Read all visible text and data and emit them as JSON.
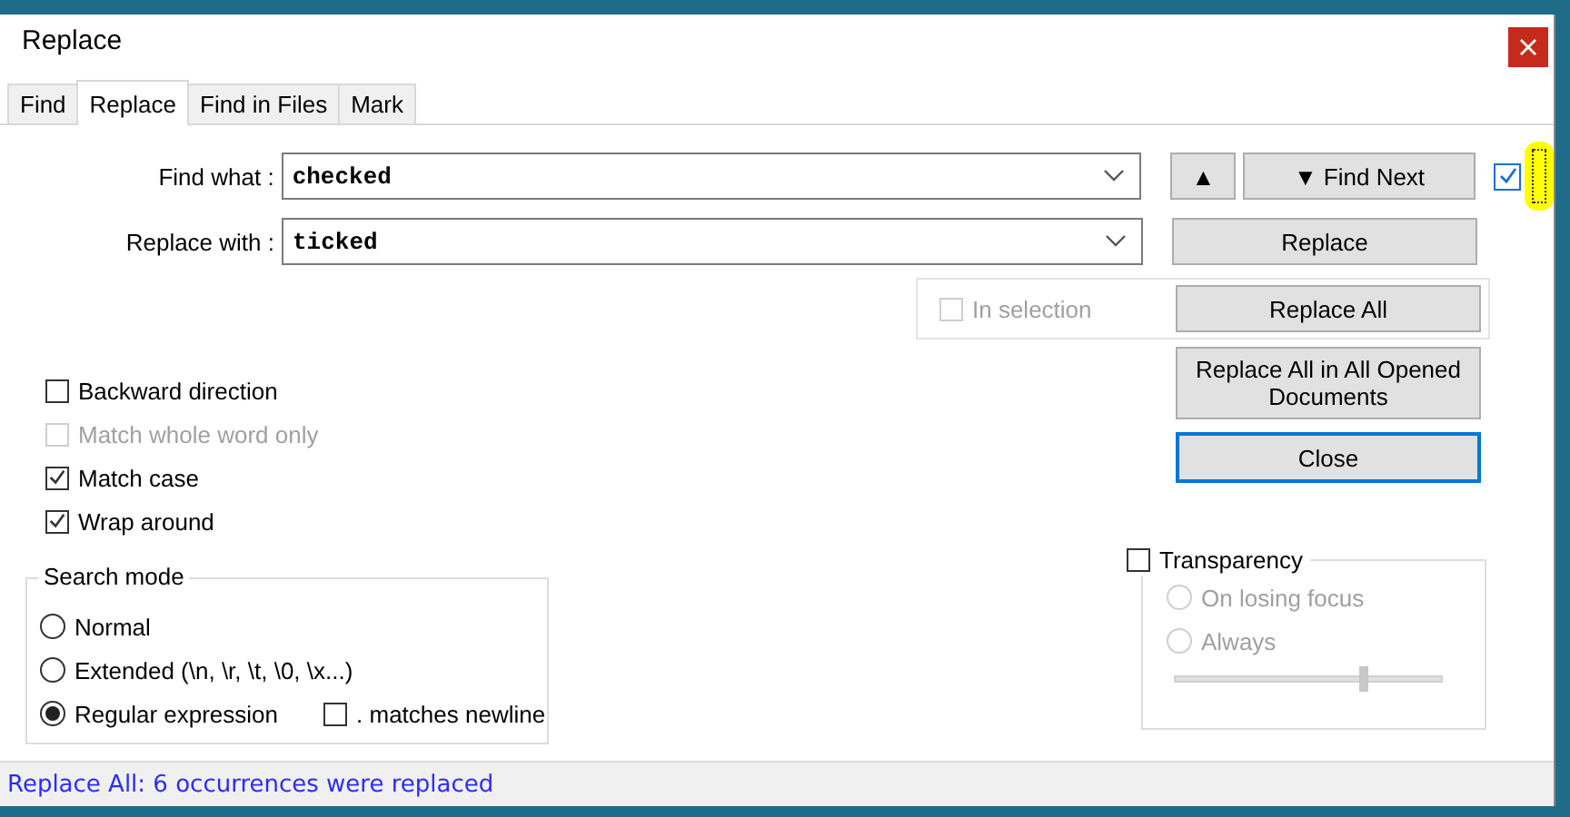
{
  "window": {
    "title": "Replace"
  },
  "tabs": [
    {
      "label": "Find",
      "selected": false
    },
    {
      "label": "Replace",
      "selected": true
    },
    {
      "label": "Find in Files",
      "selected": false
    },
    {
      "label": "Mark",
      "selected": false
    }
  ],
  "fields": [
    {
      "label": "Find what :",
      "value": "checked"
    },
    {
      "label": "Replace with :",
      "value": "ticked"
    }
  ],
  "up_button": {
    "label": "▲"
  },
  "find_next_button": {
    "label": "▼ Find Next"
  },
  "side_checkbox": {
    "checked": true
  },
  "replace_button": {
    "label": "Replace"
  },
  "in_selection": {
    "label": "In selection",
    "checked": false,
    "disabled": true
  },
  "replace_all_button": {
    "label": "Replace All"
  },
  "replace_all_opened_button": {
    "label": "Replace All in All Opened Documents"
  },
  "close_button": {
    "label": "Close",
    "focused": true
  },
  "options": [
    {
      "label": "Backward direction",
      "checked": false,
      "disabled": false
    },
    {
      "label": "Match whole word only",
      "checked": false,
      "disabled": true
    },
    {
      "label": "Match case",
      "checked": true,
      "disabled": false
    },
    {
      "label": "Wrap around",
      "checked": true,
      "disabled": false
    }
  ],
  "search_mode": {
    "title": "Search mode",
    "modes": [
      {
        "label": "Normal",
        "selected": false
      },
      {
        "label": "Extended (\\n, \\r, \\t, \\0, \\x...)",
        "selected": false
      },
      {
        "label": "Regular expression",
        "selected": true
      }
    ],
    "matches_newline": {
      "label": ". matches newline",
      "checked": false
    }
  },
  "transparency": {
    "label": "Transparency",
    "checked": false,
    "modes": [
      {
        "label": "On losing focus",
        "selected": false,
        "disabled": true
      },
      {
        "label": "Always",
        "selected": false,
        "disabled": true
      }
    ],
    "level": 0.7
  },
  "status_bar": {
    "text": "Replace All: 6 occurrences were replaced"
  }
}
